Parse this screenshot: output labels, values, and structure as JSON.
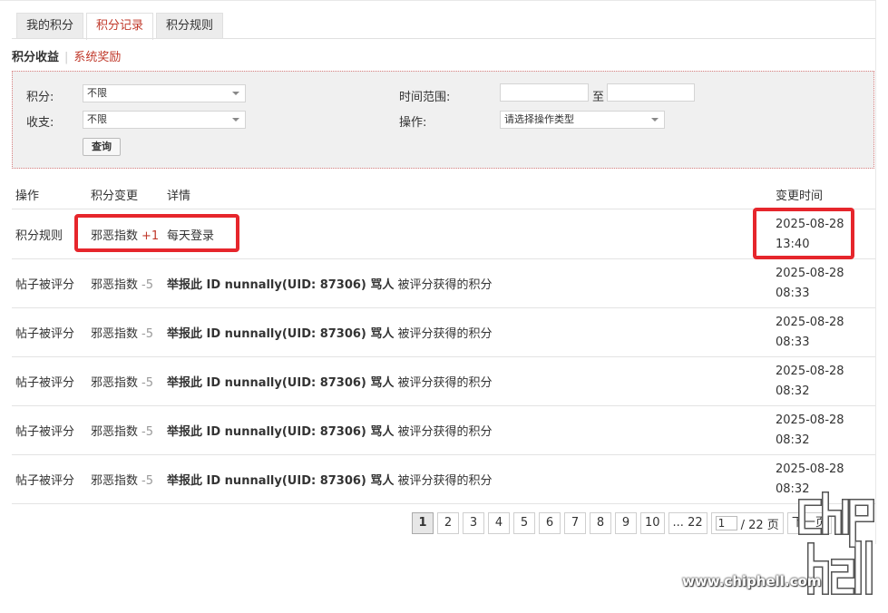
{
  "tabs": [
    "我的积分",
    "积分记录",
    "积分规则"
  ],
  "subnav": {
    "current": "积分收益",
    "link": "系统奖励"
  },
  "filter": {
    "points_label": "积分:",
    "points_value": "不限",
    "inout_label": "收支:",
    "inout_value": "不限",
    "time_label": "时间范围:",
    "time_to": "至",
    "op_label": "操作:",
    "op_value": "请选择操作类型",
    "query_button": "查询"
  },
  "table": {
    "headers": {
      "op": "操作",
      "change": "积分变更",
      "detail": "详情",
      "time": "变更时间"
    },
    "rows": [
      {
        "op": "积分规则",
        "change_name": "邪恶指数",
        "change_delta": "+1",
        "detail_bold": "",
        "detail_text": "每天登录",
        "date": "2025-08-28",
        "time": "13:40"
      },
      {
        "op": "帖子被评分",
        "change_name": "邪恶指数",
        "change_delta": "-5",
        "detail_bold": "举报此 ID nunnally(UID: 87306) 骂人",
        "detail_text": "被评分获得的积分",
        "date": "2025-08-28",
        "time": "08:33"
      },
      {
        "op": "帖子被评分",
        "change_name": "邪恶指数",
        "change_delta": "-5",
        "detail_bold": "举报此 ID nunnally(UID: 87306) 骂人",
        "detail_text": "被评分获得的积分",
        "date": "2025-08-28",
        "time": "08:33"
      },
      {
        "op": "帖子被评分",
        "change_name": "邪恶指数",
        "change_delta": "-5",
        "detail_bold": "举报此 ID nunnally(UID: 87306) 骂人",
        "detail_text": "被评分获得的积分",
        "date": "2025-08-28",
        "time": "08:32"
      },
      {
        "op": "帖子被评分",
        "change_name": "邪恶指数",
        "change_delta": "-5",
        "detail_bold": "举报此 ID nunnally(UID: 87306) 骂人",
        "detail_text": "被评分获得的积分",
        "date": "2025-08-28",
        "time": "08:32"
      },
      {
        "op": "帖子被评分",
        "change_name": "邪恶指数",
        "change_delta": "-5",
        "detail_bold": "举报此 ID nunnally(UID: 87306) 骂人",
        "detail_text": "被评分获得的积分",
        "date": "2025-08-28",
        "time": "08:32"
      }
    ]
  },
  "pager": {
    "pages": [
      "1",
      "2",
      "3",
      "4",
      "5",
      "6",
      "7",
      "8",
      "9",
      "10",
      "... 22"
    ],
    "current": "1",
    "jump_value": "1",
    "total": "/ 22 页",
    "next": "下一页"
  },
  "watermark": {
    "url": "www.chiphell.com",
    "logo": "chip hell"
  },
  "colors": {
    "accent": "#c0392b",
    "highlight": "#e6262c",
    "filter_bg": "#f0f0f0"
  }
}
